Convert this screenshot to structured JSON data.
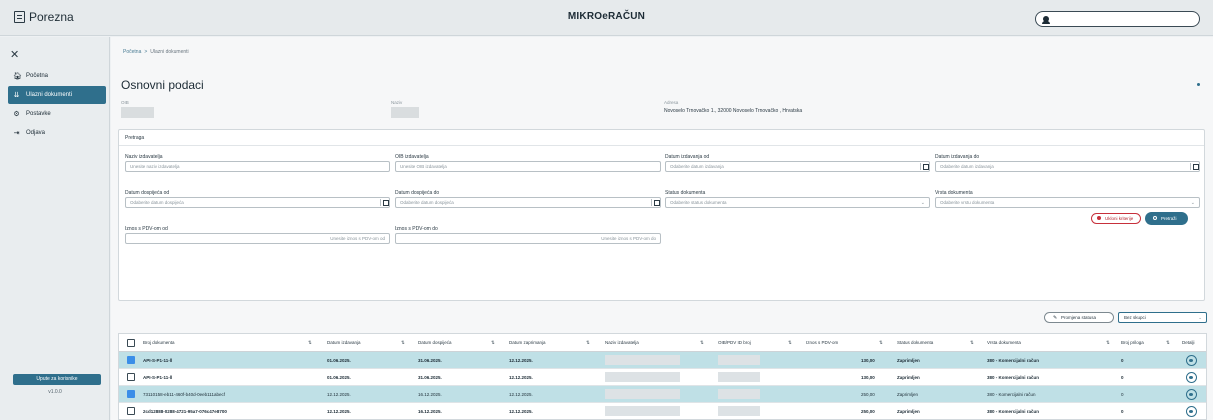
{
  "header": {
    "brand": "Porezna",
    "app_title": "MIKROeRAČUN",
    "user_initial": ""
  },
  "sidebar": {
    "items": [
      {
        "label": "Početna",
        "icon": "home-icon"
      },
      {
        "label": "Ulazni dokumenti",
        "icon": "documents-icon",
        "active": true
      },
      {
        "label": "Postavke",
        "icon": "gear-icon"
      },
      {
        "label": "Odjava",
        "icon": "logout-icon"
      }
    ],
    "user_settings_label": "Upute za korisnike",
    "version": "v1.0.0"
  },
  "breadcrumb": {
    "home": "Početna",
    "separator": ">",
    "current": "Ulazni dokumenti"
  },
  "page_title": "Osnovni podaci",
  "basic_info": {
    "oib_label": "OIB",
    "name_label": "Naziv",
    "address_label": "Adresa",
    "address_value": "Novoselo Trnovačko 1., 32000 Novoselo Trnovačko , Hrvatska"
  },
  "filters": {
    "title": "Pretraga",
    "supplier_name": {
      "label": "Naziv izdavatelja",
      "placeholder": "Unesite naziv izdavatelja"
    },
    "supplier_oib": {
      "label": "OIB izdavatelja",
      "placeholder": "Unesite OIB izdavatelja"
    },
    "issue_date_from": {
      "label": "Datum izdavanja od",
      "placeholder": "Odaberite datum izdavanja"
    },
    "issue_date_to": {
      "label": "Datum izdavanja do",
      "placeholder": "Odaberite datum izdavanja"
    },
    "due_date_from": {
      "label": "Datum dospijeća od",
      "placeholder": "Odaberite datum dospijeća"
    },
    "due_date_to": {
      "label": "Datum dospijeća do",
      "placeholder": "Odaberite datum dospijeća"
    },
    "doc_status": {
      "label": "Status dokumenta",
      "placeholder": "Odaberite status dokumenta"
    },
    "doc_type": {
      "label": "Vrsta dokumenta",
      "placeholder": "Odaberite vrstu dokumenta"
    },
    "amount_from": {
      "label": "Iznos s PDV-om od",
      "placeholder": "Unesite iznos s PDV-om od"
    },
    "amount_to": {
      "label": "Iznos s PDV-om do",
      "placeholder": "Unesite iznos s PDV-om do"
    },
    "clear_label": "Ukloni kriterije",
    "search_label": "Pretraži"
  },
  "toolbar": {
    "change_status_label": "Promjena statusa",
    "group_select_value": "Bez skupci"
  },
  "table": {
    "columns": [
      "Broj dokumenta",
      "Datum izdavanja",
      "Datum dospijeća",
      "Datum zaprimanja",
      "Naziv izdavatelja",
      "OIB/PDV ID broj",
      "Iznos s PDV-om",
      "Status dokumenta",
      "Vrsta dokumenta",
      "Broj priloga",
      "Detalji"
    ],
    "rows": [
      {
        "selected": true,
        "doc_no": "API-S-P1-11-ll",
        "issue": "01.06.2025.",
        "due": "31.06.2025.",
        "received": "12.12.2025.",
        "amount": "130,00",
        "status": "Zaprimljen",
        "type": "380 - Komercijalni račun",
        "attachments": "0"
      },
      {
        "selected": false,
        "doc_no": "API-S-P1-11-ll",
        "issue": "01.06.2025.",
        "due": "31.06.2025.",
        "received": "12.12.2025.",
        "amount": "130,00",
        "status": "Zaprimljen",
        "type": "380 - Komercijalni račun",
        "attachments": "0"
      },
      {
        "selected": true,
        "doc_no": "73110158-eb11-460f-b40d-0eeb111abecf",
        "issue": "12.12.2025.",
        "due": "16.12.2025.",
        "received": "12.12.2025.",
        "amount": "250,00",
        "status": "Zaprimljen",
        "type": "380 - Komercijalni račun",
        "attachments": "0"
      },
      {
        "selected": false,
        "doc_no": "2cd12888-0288-4721-95a7-076c47e8700",
        "issue": "12.12.2025.",
        "due": "16.12.2025.",
        "received": "12.12.2025.",
        "amount": "250,00",
        "status": "Zaprimljen",
        "type": "380 - Komercijalni račun",
        "attachments": "0"
      }
    ]
  },
  "colors": {
    "accent": "#2f6f8c",
    "selected_row": "#bfe0e6",
    "danger": "#c7303b",
    "checkbox_on": "#3b8ee8"
  }
}
